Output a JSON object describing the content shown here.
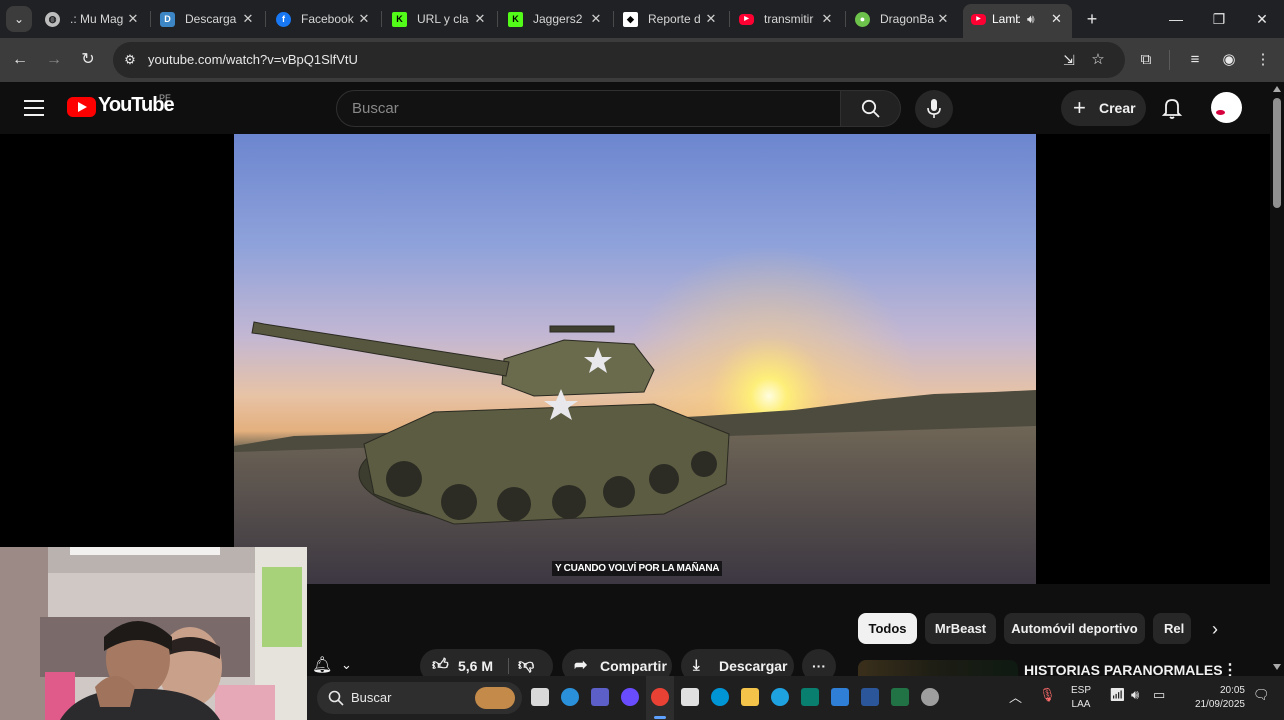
{
  "browser": {
    "tabs": [
      {
        "title": ".: Mu Mag",
        "favicon": "globe-icon",
        "color": "#bdbdbd"
      },
      {
        "title": "Descarga",
        "favicon": "site-icon",
        "color": "#3d86c6"
      },
      {
        "title": "Facebook",
        "favicon": "facebook-icon",
        "color": "#1877f2"
      },
      {
        "title": "URL y cla",
        "favicon": "k-icon",
        "color": "#53fc18"
      },
      {
        "title": "Jaggers2",
        "favicon": "k-icon",
        "color": "#53fc18"
      },
      {
        "title": "Reporte d",
        "favicon": "diamond-icon",
        "color": "#ffffff"
      },
      {
        "title": "transmitir",
        "favicon": "youtube-icon",
        "color": "#ff0033"
      },
      {
        "title": "DragonBa",
        "favicon": "dragon-icon",
        "color": "#6cc24a"
      },
      {
        "title": "Lamb",
        "favicon": "youtube-icon",
        "color": "#ff0033"
      }
    ],
    "url": "youtube.com/watch?v=vBpQ1SlfVtU"
  },
  "youtube": {
    "logo_text": "YouTube",
    "country_code": "PE",
    "search_placeholder": "Buscar",
    "create_label": "Crear",
    "accent_color": "#ff0000"
  },
  "video": {
    "subtitle": "Y CUANDO VOLVÍ POR LA MAÑANA"
  },
  "actions": {
    "likes": "5,6 M",
    "share": "Compartir",
    "download": "Descargar",
    "more": "···"
  },
  "chips": [
    "Todos",
    "MrBeast",
    "Automóvil deportivo",
    "Rel"
  ],
  "recommendation": {
    "title": "HISTORIAS PARANORMALES"
  },
  "taskbar": {
    "search_label": "Buscar",
    "lang_line1": "ESP",
    "lang_line2": "LAA",
    "time": "20:05",
    "date": "21/09/2025"
  }
}
